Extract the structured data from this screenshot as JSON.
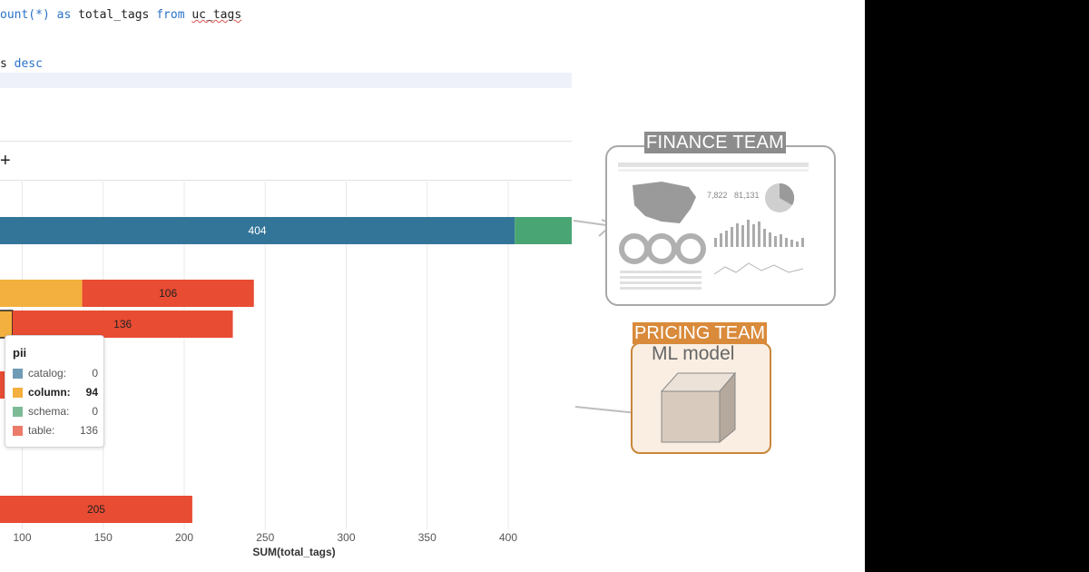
{
  "code": {
    "line1": {
      "frag": "ount(*)",
      "kw_as": "as",
      "ident": "total_tags",
      "kw_from": "from",
      "table": "uc_tags"
    },
    "line2": {
      "frag": "s",
      "kw_desc": "desc"
    }
  },
  "toolbar": {
    "plus_label": "+"
  },
  "chart_data": {
    "type": "bar",
    "orientation": "horizontal",
    "stacked": true,
    "xlabel": "SUM(total_tags)",
    "x_ticks": [
      "100",
      "150",
      "200",
      "250",
      "300",
      "350",
      "400"
    ],
    "series_colors": {
      "catalog": "#337599",
      "column": "#f3b03e",
      "schema": "#4aa574",
      "table": "#e84c33"
    },
    "bars": [
      {
        "segments": [
          {
            "series": "catalog",
            "value": 404,
            "label": "404"
          },
          {
            "series": "schema",
            "value": 37,
            "label": ""
          }
        ]
      },
      {
        "segments": [
          {
            "series": "column",
            "value": 137,
            "label": ""
          },
          {
            "series": "table",
            "value": 106,
            "label": "106"
          }
        ]
      },
      {
        "name": "pii",
        "segments": [
          {
            "series": "column",
            "value": 94,
            "label": ""
          },
          {
            "series": "table",
            "value": 136,
            "label": "136"
          }
        ]
      },
      {
        "segments": [
          {
            "series": "table",
            "value": 205,
            "label": "205"
          }
        ]
      }
    ]
  },
  "tooltip": {
    "title": "pii",
    "rows": [
      {
        "label": "catalog:",
        "value": "0",
        "color": "#6f9bb6"
      },
      {
        "label": "column:",
        "value": "94",
        "color": "#f3b03e"
      },
      {
        "label": "schema:",
        "value": "0",
        "color": "#7dbb97"
      },
      {
        "label": "table:",
        "value": "136",
        "color": "#ec7a68"
      }
    ]
  },
  "finance": {
    "label": "FINANCE TEAM",
    "stat1": "7,822",
    "stat2": "81,131"
  },
  "pricing": {
    "label": "PRICING TEAM",
    "model_label": "ML model"
  }
}
